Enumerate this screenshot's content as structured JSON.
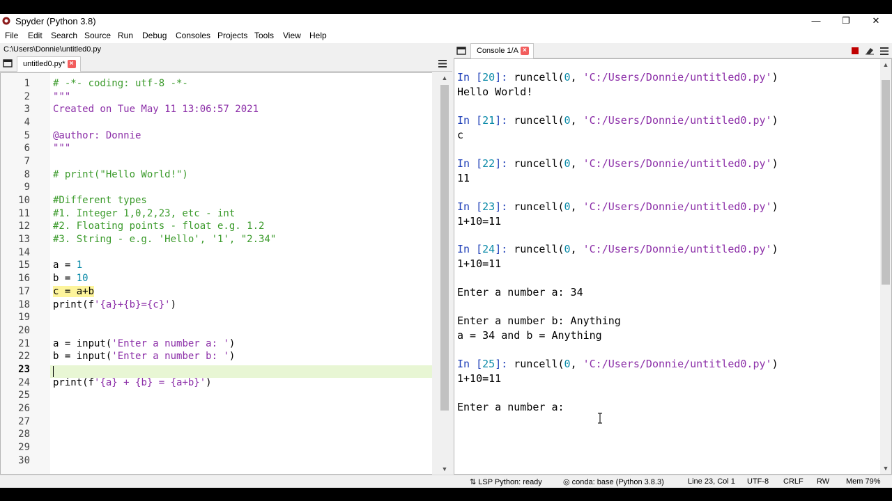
{
  "window": {
    "title": "Spyder (Python 3.8)",
    "minimize": "—",
    "maximize": "❐",
    "close": "✕"
  },
  "menu": [
    "File",
    "Edit",
    "Search",
    "Source",
    "Run",
    "Debug",
    "Consoles",
    "Projects",
    "Tools",
    "View",
    "Help"
  ],
  "editor": {
    "path": "C:\\Users\\Donnie\\untitled0.py",
    "tab_label": "untitled0.py*",
    "current_line": 23,
    "lines": [
      "# -*- coding: utf-8 -*-",
      "\"\"\"",
      "Created on Tue May 11 13:06:57 2021",
      "",
      "@author: Donnie",
      "\"\"\"",
      "",
      "# print(\"Hello World!\")",
      "",
      "#Different types",
      "#1. Integer 1,0,2,23, etc - int",
      "#2. Floating points - float e.g. 1.2",
      "#3. String - e.g. 'Hello', '1', \"2.34\"",
      "",
      "a = 1",
      "b = 10",
      "c = a+b",
      "print(f'{a}+{b}={c}')",
      "",
      "",
      "a = input('Enter a number a: ')",
      "b = input('Enter a number b: ')",
      "",
      "print(f'{a} + {b} = {a+b}')",
      "",
      "",
      "",
      "",
      "",
      ""
    ]
  },
  "console": {
    "tab_label": "Console 1/A",
    "lines": [
      "In [20]: runcell(0, 'C:/Users/Donnie/untitled0.py')",
      "Hello World!",
      "",
      "In [21]: runcell(0, 'C:/Users/Donnie/untitled0.py')",
      "c",
      "",
      "In [22]: runcell(0, 'C:/Users/Donnie/untitled0.py')",
      "11",
      "",
      "In [23]: runcell(0, 'C:/Users/Donnie/untitled0.py')",
      "1+10=11",
      "",
      "In [24]: runcell(0, 'C:/Users/Donnie/untitled0.py')",
      "1+10=11",
      "",
      "Enter a number a: 34",
      "",
      "Enter a number b: Anything",
      "a = 34 and b = Anything",
      "",
      "In [25]: runcell(0, 'C:/Users/Donnie/untitled0.py')",
      "1+10=11",
      "",
      "Enter a number a:"
    ]
  },
  "status": {
    "lsp": "LSP Python: ready",
    "conda": "conda: base (Python 3.8.3)",
    "position": "Line 23, Col 1",
    "encoding": "UTF-8",
    "eol": "CRLF",
    "mode": "RW",
    "mem": "Mem 79%"
  },
  "colors": {
    "comment": "#3a9a2a",
    "number": "#0a8aa8",
    "string": "#8c2fa8",
    "prompt": "#1e3fb8",
    "close_tab": "#f25e5e",
    "current_line": "#e8f6d4"
  }
}
